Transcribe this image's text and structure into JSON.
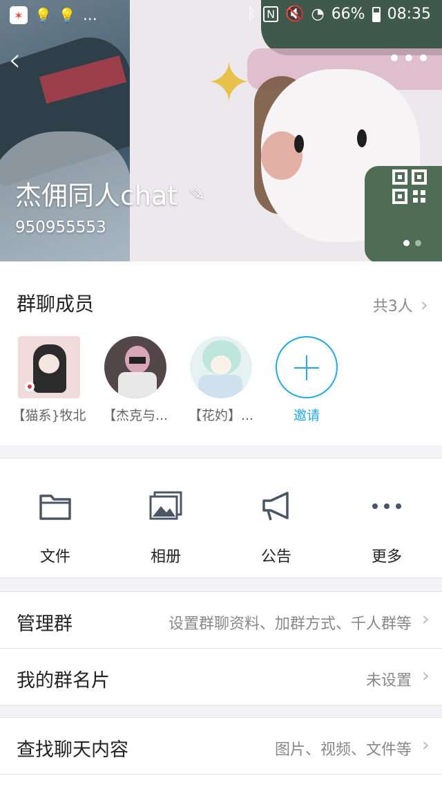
{
  "status_bar": {
    "battery": "66%",
    "time": "08:35",
    "ellipsis": "..."
  },
  "header": {
    "group_name": "杰佣同人chat",
    "group_id": "950955553",
    "back_glyph": "‹",
    "more_glyph": "•••",
    "edit_glyph": "✎",
    "carousel_pages": 2
  },
  "members": {
    "title": "群聊成员",
    "count": "共3人",
    "chevron": "›",
    "list": [
      {
        "name": "【猫系}牧北"
      },
      {
        "name": "【杰克与..."
      },
      {
        "name": "【花妁】..."
      }
    ],
    "invite_label": "邀请"
  },
  "actions": [
    {
      "label": "文件",
      "icon": "folder-icon"
    },
    {
      "label": "相册",
      "icon": "photo-album-icon"
    },
    {
      "label": "公告",
      "icon": "megaphone-icon"
    },
    {
      "label": "更多",
      "icon": "more-dots-icon"
    }
  ],
  "rows": {
    "manage": {
      "title": "管理群",
      "value": "设置群聊资料、加群方式、千人群等"
    },
    "card": {
      "title": "我的群名片",
      "value": "未设置"
    },
    "search": {
      "title": "查找聊天内容",
      "value": "图片、视频、文件等"
    }
  },
  "colors": {
    "accent": "#21a9e1"
  }
}
